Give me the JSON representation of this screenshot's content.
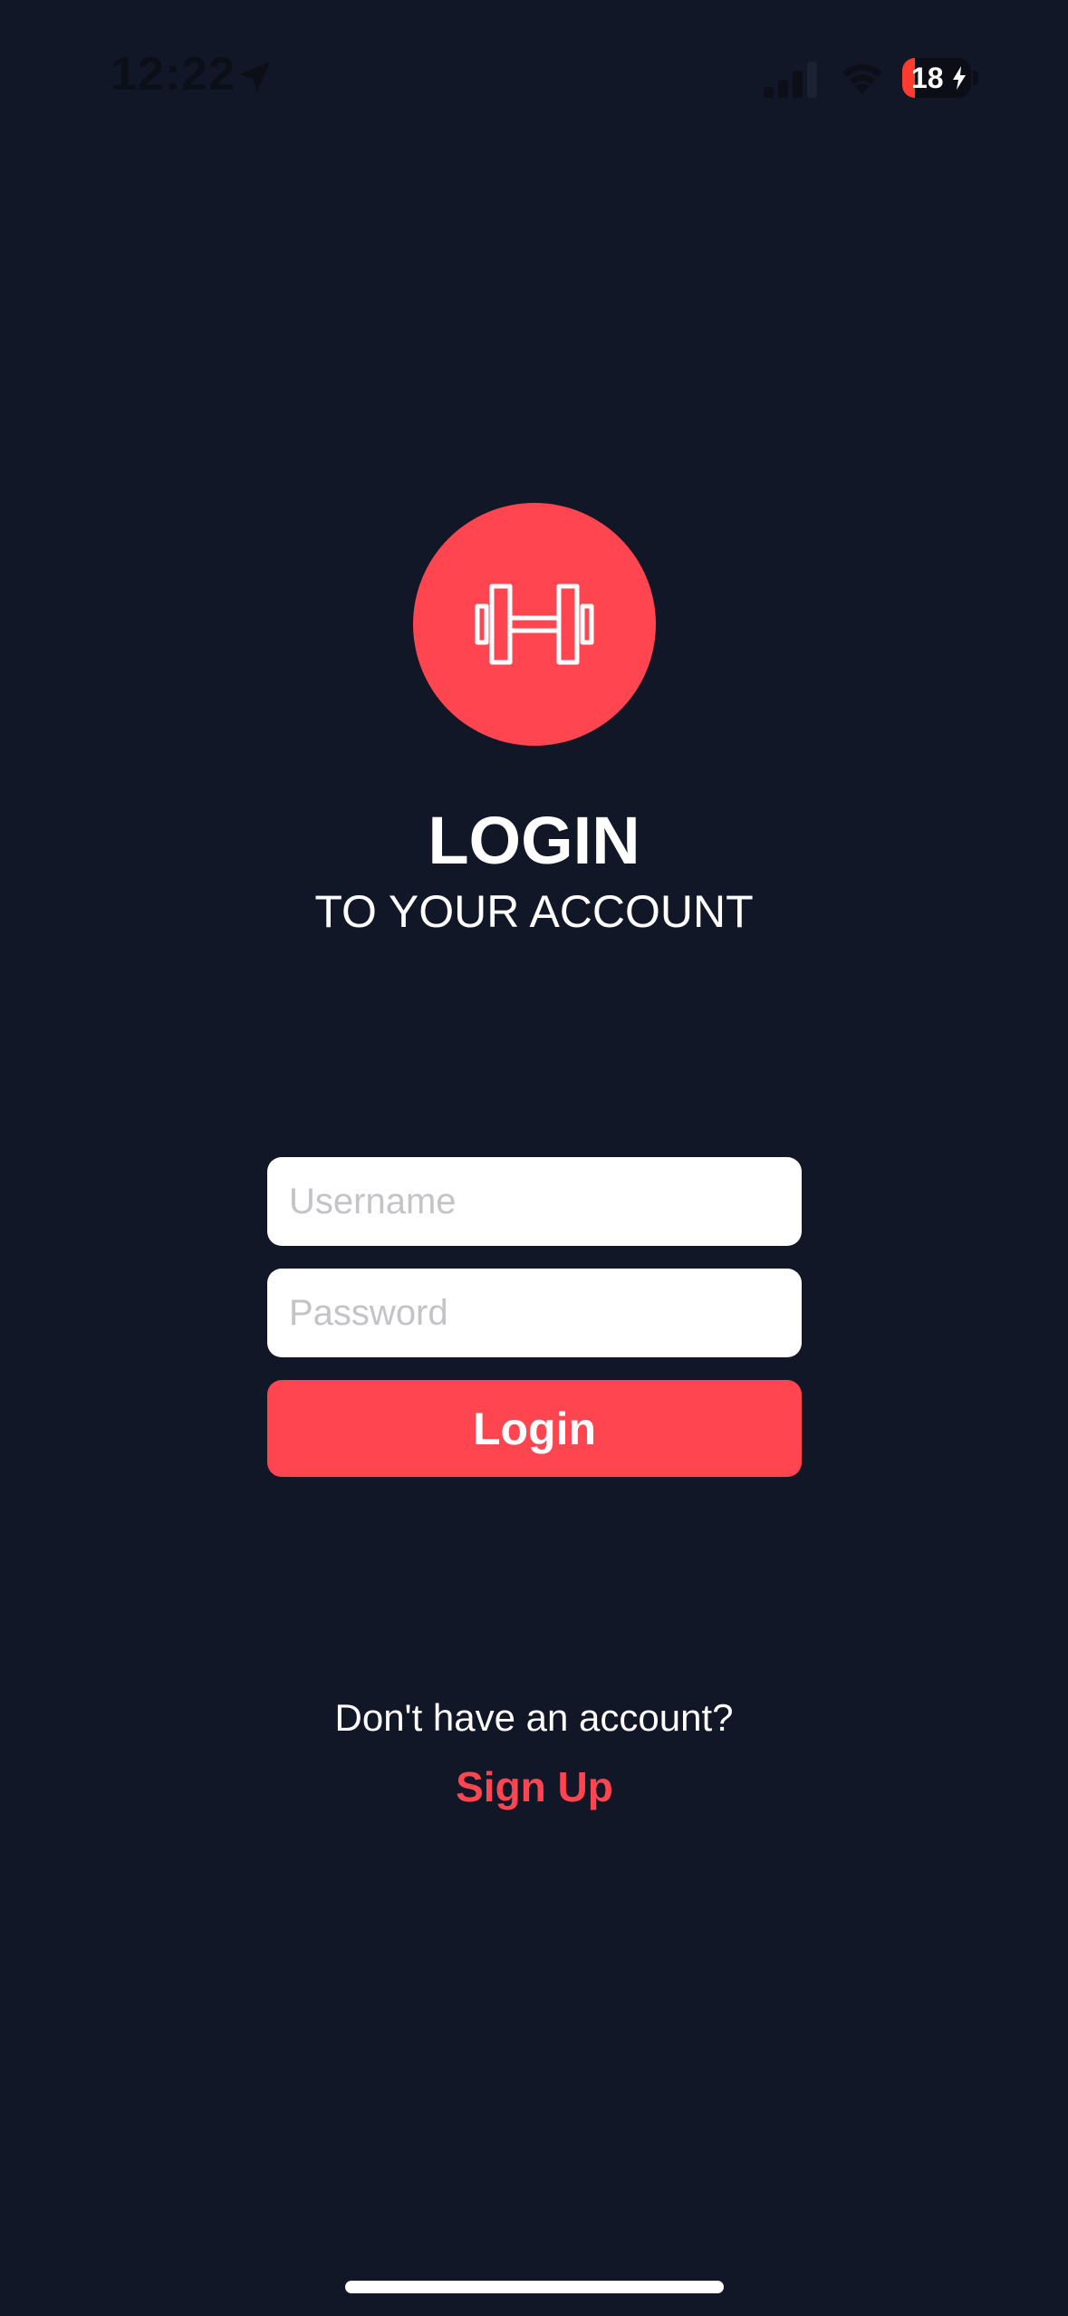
{
  "status_bar": {
    "time": "12:22",
    "battery_level": "18",
    "battery_percent": 18,
    "location_icon": "location-arrow-icon",
    "signal_icon": "cellular-signal-icon",
    "wifi_icon": "wifi-icon",
    "charging_icon": "bolt-icon",
    "low_battery_color": "#ff3b30"
  },
  "logo": {
    "icon": "dumbbell-icon",
    "color": "#ff4550"
  },
  "header": {
    "title": "LOGIN",
    "subtitle": "TO YOUR ACCOUNT"
  },
  "form": {
    "username_placeholder": "Username",
    "username_value": "",
    "password_placeholder": "Password",
    "password_value": "",
    "login_label": "Login"
  },
  "signup": {
    "prompt": "Don't have an account?",
    "link_label": "Sign Up"
  },
  "colors": {
    "background": "#121727",
    "accent": "#ff4550",
    "text": "#ffffff",
    "placeholder": "#c4c4c8"
  }
}
